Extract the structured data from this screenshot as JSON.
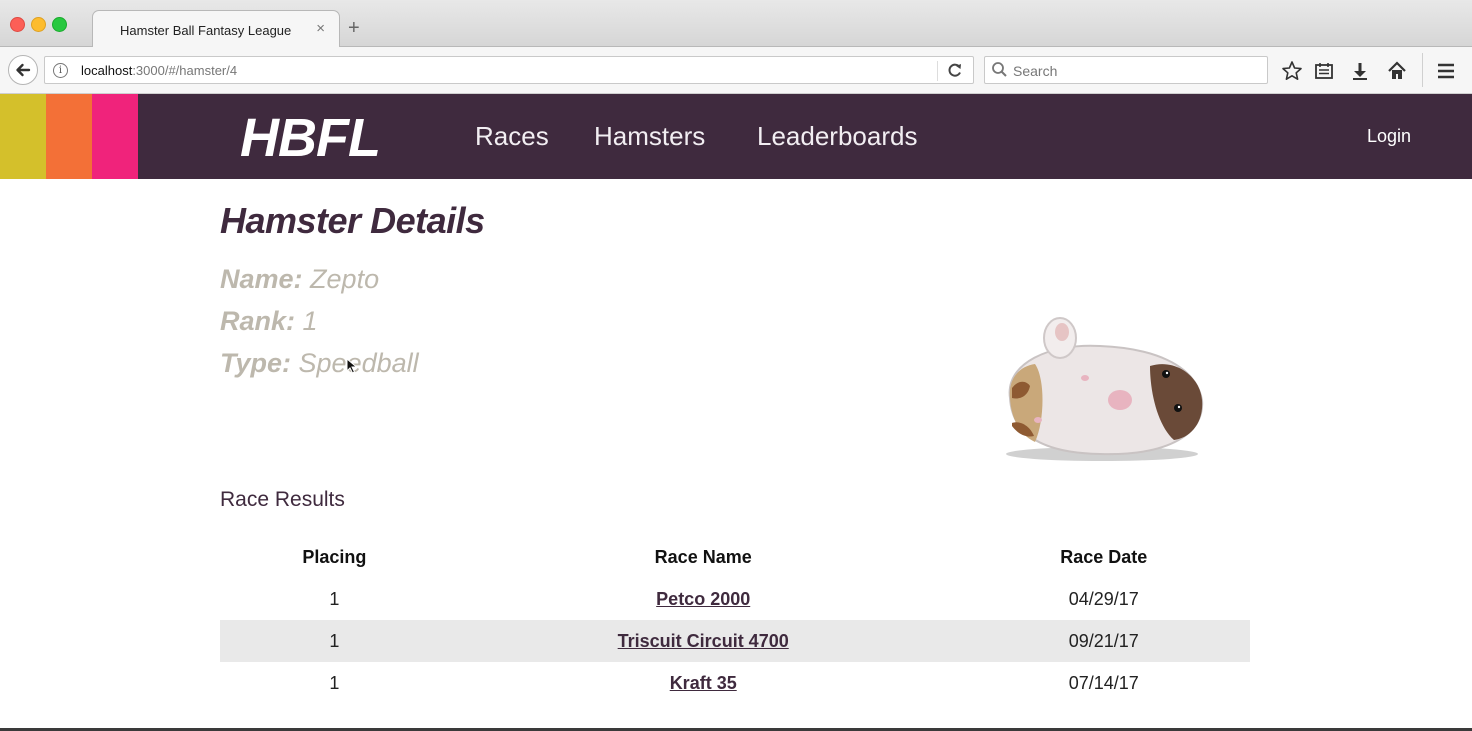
{
  "browser": {
    "tab_title": "Hamster Ball Fantasy League",
    "tab_close": "×",
    "new_tab": "+",
    "url_host": "localhost",
    "url_path": ":3000/#/hamster/4",
    "search_placeholder": "Search"
  },
  "site": {
    "colors": {
      "header_bg": "#3f2a3e",
      "stripe1": "#d4c02b",
      "stripe2": "#f37037",
      "stripe3": "#f0237b"
    },
    "logo": "HBFL",
    "nav": [
      "Races",
      "Hamsters",
      "Leaderboards"
    ],
    "login": "Login"
  },
  "details": {
    "title": "Hamster Details",
    "name_label": "Name:",
    "name_value": "Zepto",
    "rank_label": "Rank:",
    "rank_value": "1",
    "type_label": "Type:",
    "type_value": "Speedball"
  },
  "results": {
    "title": "Race Results",
    "headers": [
      "Placing",
      "Race Name",
      "Race Date"
    ],
    "rows": [
      {
        "placing": "1",
        "race": "Petco 2000",
        "date": "04/29/17"
      },
      {
        "placing": "1",
        "race": "Triscuit Circuit 4700",
        "date": "09/21/17"
      },
      {
        "placing": "1",
        "race": "Kraft 35",
        "date": "07/14/17"
      }
    ]
  }
}
